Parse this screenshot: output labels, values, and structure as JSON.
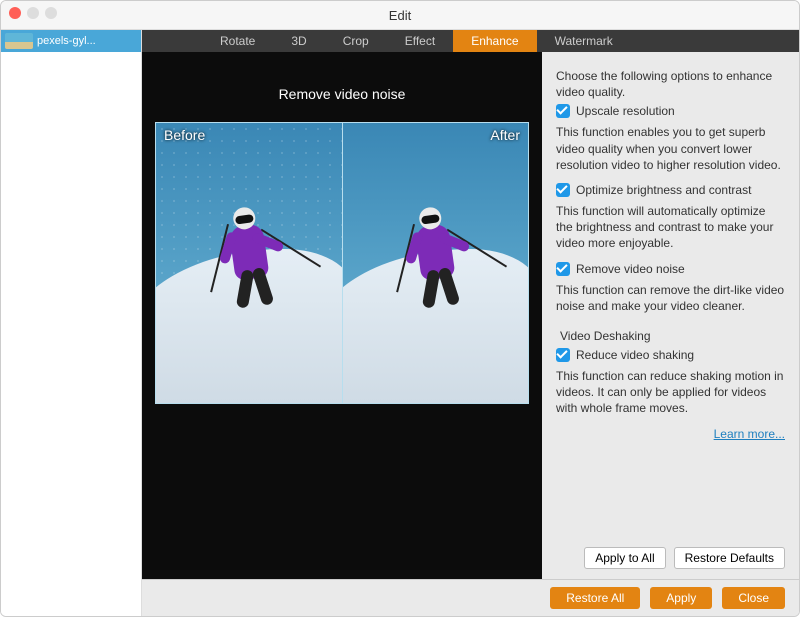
{
  "window": {
    "title": "Edit"
  },
  "sidebar": {
    "items": [
      {
        "label": "pexels-gyl..."
      }
    ]
  },
  "tabs": {
    "items": [
      {
        "label": "Rotate"
      },
      {
        "label": "3D"
      },
      {
        "label": "Crop"
      },
      {
        "label": "Effect"
      },
      {
        "label": "Enhance"
      },
      {
        "label": "Watermark"
      }
    ],
    "active_index": 4
  },
  "preview": {
    "title": "Remove video noise",
    "before_label": "Before",
    "after_label": "After"
  },
  "panel": {
    "intro": "Choose the following options to enhance video quality.",
    "opt1_label": "Upscale resolution",
    "opt1_desc": "This function enables you to get superb video quality when you convert lower resolution video to higher resolution video.",
    "opt2_label": "Optimize brightness and contrast",
    "opt2_desc": "This function will automatically optimize the brightness and contrast to make your video more enjoyable.",
    "opt3_label": "Remove video noise",
    "opt3_desc": "This function can remove the dirt-like video noise and make your video cleaner.",
    "deshake_header": "Video Deshaking",
    "opt4_label": "Reduce video shaking",
    "opt4_desc": "This function can reduce shaking motion in videos. It can only be applied for videos with whole frame moves.",
    "learn_more": "Learn more...",
    "apply_all": "Apply to All",
    "restore_defaults": "Restore Defaults"
  },
  "footer": {
    "restore_all": "Restore All",
    "apply": "Apply",
    "close": "Close"
  }
}
